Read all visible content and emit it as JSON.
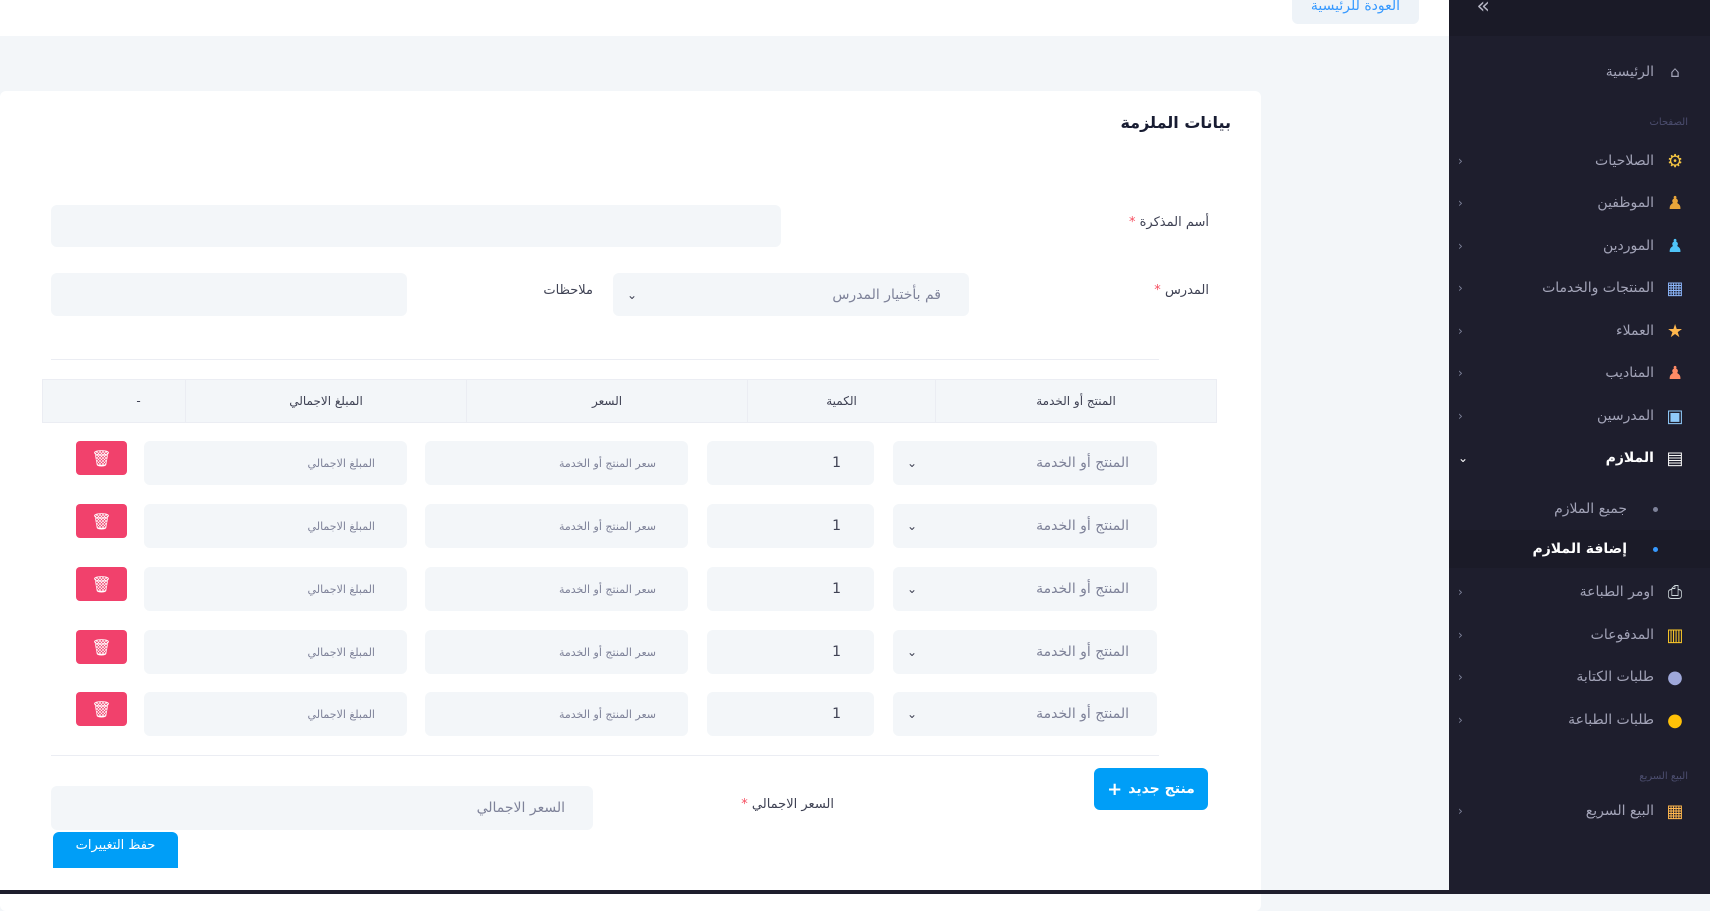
{
  "topbar": {
    "back_label": "العودة للرئيسية"
  },
  "sidebar": {
    "toggle_icon": "double-chevron-icon",
    "home": "الرئيسية",
    "section_pages": "الصفحات",
    "items": [
      {
        "label": "الصلاحيات",
        "icon": "permissions-icon"
      },
      {
        "label": "الموظفين",
        "icon": "employees-icon"
      },
      {
        "label": "الموردين",
        "icon": "suppliers-icon"
      },
      {
        "label": "المنتجات والخدمات",
        "icon": "products-icon"
      },
      {
        "label": "العملاء",
        "icon": "clients-icon"
      },
      {
        "label": "المناديب",
        "icon": "delegates-icon"
      },
      {
        "label": "المدرسين",
        "icon": "teachers-icon"
      },
      {
        "label": "الملازم",
        "icon": "booklets-icon"
      },
      {
        "label": "اومر الطباعة",
        "icon": "printer-icon"
      },
      {
        "label": "المدفوعات",
        "icon": "payments-icon"
      },
      {
        "label": "طلبات الكتابة",
        "icon": "writing-requests-icon"
      },
      {
        "label": "طلبات الطباعة",
        "icon": "print-requests-icon"
      }
    ],
    "sub_items": [
      {
        "label": "جميع الملازم"
      },
      {
        "label": "إضافة الملازم"
      }
    ],
    "section_quick": "البيع السريع",
    "quick_sale": "البيع السريع"
  },
  "form": {
    "title": "بيانات الملزمة",
    "memo_name_label": "أسم المذكرة",
    "teacher_label": "المدرس",
    "teacher_placeholder": "قم بأختيار المدرس",
    "notes_label": "ملاحظات",
    "required_mark": "*",
    "table": {
      "headers": [
        "المنتج أو الخدمة",
        "الكمية",
        "السعر",
        "المبلغ الاجمالي",
        "-"
      ],
      "rows": [
        {
          "product": "المنتج أو الخدمة",
          "qty": "1",
          "price": "سعر المنتج أو الخدمة",
          "total": "المبلغ الاجمالي"
        },
        {
          "product": "المنتج أو الخدمة",
          "qty": "1",
          "price": "سعر المنتج أو الخدمة",
          "total": "المبلغ الاجمالي"
        },
        {
          "product": "المنتج أو الخدمة",
          "qty": "1",
          "price": "سعر المنتج أو الخدمة",
          "total": "المبلغ الاجمالي"
        },
        {
          "product": "المنتج أو الخدمة",
          "qty": "1",
          "price": "سعر المنتج أو الخدمة",
          "total": "المبلغ الاجمالي"
        },
        {
          "product": "المنتج أو الخدمة",
          "qty": "1",
          "price": "سعر المنتج أو الخدمة",
          "total": "المبلغ الاجمالي"
        }
      ]
    },
    "add_product": "منتج جديد",
    "total_price_label": "السعر الاجمالي",
    "total_price_placeholder": "السعر الاجمالي",
    "save_label": "حفظ التغييرات"
  },
  "colors": {
    "sidebar_bg": "#1e1e2d",
    "primary": "#009ef7",
    "danger": "#f1416c"
  }
}
